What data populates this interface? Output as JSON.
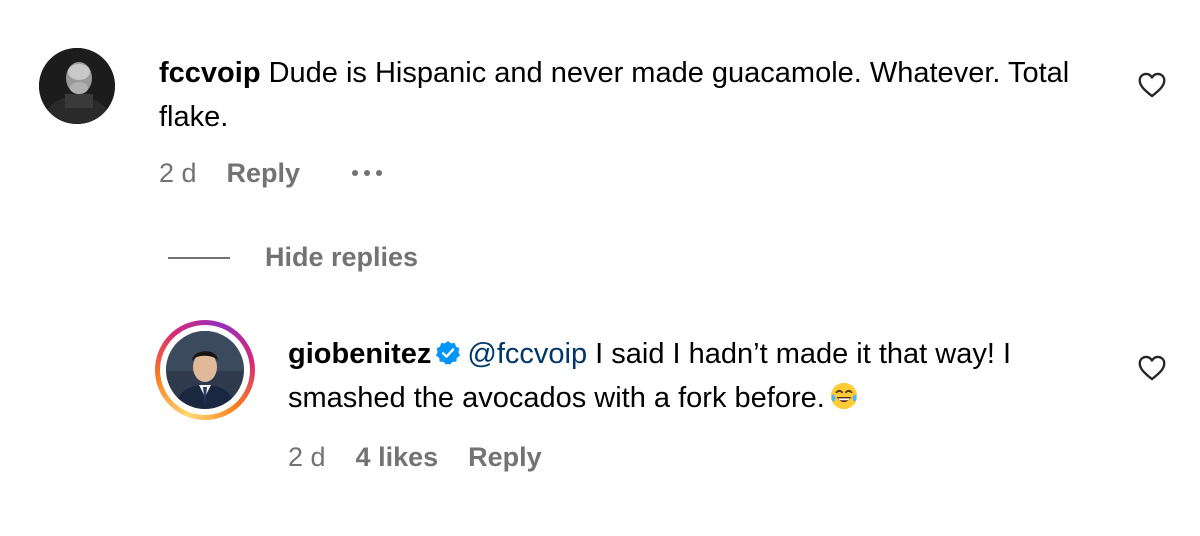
{
  "comments": [
    {
      "username": "fccvoip",
      "text": "Dude is Hispanic and never made guacamole. Whatever. Total flake.",
      "time": "2 d",
      "reply_label": "Reply",
      "avatar_icon": "user-avatar-photo",
      "like_icon": "heart-outline-icon"
    }
  ],
  "replies_toggle": {
    "label": "Hide replies"
  },
  "replies": [
    {
      "username": "giobenitez",
      "verified": true,
      "mention": "@fccvoip",
      "text": "I said I hadn’t made it that way! I smashed the avocados with a fork before.",
      "emoji": "😂",
      "time": "2 d",
      "likes": "4 likes",
      "reply_label": "Reply",
      "avatar_icon": "user-avatar-photo-story-ring",
      "like_icon": "heart-outline-icon"
    }
  ],
  "colors": {
    "text": "#000000",
    "secondary": "#737373",
    "mention": "#00376b",
    "verified": "#0095f6"
  }
}
